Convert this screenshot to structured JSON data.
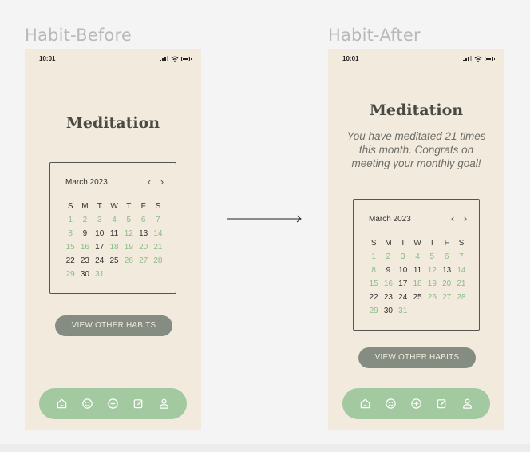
{
  "labels": {
    "before": "Habit-Before",
    "after": "Habit-After"
  },
  "status": {
    "time": "10:01"
  },
  "screen": {
    "title": "Meditation",
    "view_button": "VIEW OTHER HABITS"
  },
  "after_message": "You have meditated 21 times this month. Congrats on meeting your monthly goal!",
  "calendar": {
    "month": "March 2023",
    "prev_icon": "chevron-left-icon",
    "next_icon": "chevron-right-icon",
    "weekdays": [
      "S",
      "M",
      "T",
      "W",
      "T",
      "F",
      "S"
    ],
    "days": [
      {
        "n": "1",
        "s": "green"
      },
      {
        "n": "2",
        "s": "green"
      },
      {
        "n": "3",
        "s": "green"
      },
      {
        "n": "4",
        "s": "green"
      },
      {
        "n": "5",
        "s": "green"
      },
      {
        "n": "6",
        "s": "green"
      },
      {
        "n": "7",
        "s": "green"
      },
      {
        "n": "8",
        "s": "green"
      },
      {
        "n": "9",
        "s": "dark"
      },
      {
        "n": "10",
        "s": "dark"
      },
      {
        "n": "11",
        "s": "dark"
      },
      {
        "n": "12",
        "s": "green"
      },
      {
        "n": "13",
        "s": "dark"
      },
      {
        "n": "14",
        "s": "green"
      },
      {
        "n": "15",
        "s": "green"
      },
      {
        "n": "16",
        "s": "green"
      },
      {
        "n": "17",
        "s": "dark"
      },
      {
        "n": "18",
        "s": "green"
      },
      {
        "n": "19",
        "s": "green"
      },
      {
        "n": "20",
        "s": "green"
      },
      {
        "n": "21",
        "s": "green"
      },
      {
        "n": "22",
        "s": "dark"
      },
      {
        "n": "23",
        "s": "dark"
      },
      {
        "n": "24",
        "s": "dark"
      },
      {
        "n": "25",
        "s": "dark"
      },
      {
        "n": "26",
        "s": "green"
      },
      {
        "n": "27",
        "s": "green"
      },
      {
        "n": "28",
        "s": "green"
      },
      {
        "n": "29",
        "s": "green"
      },
      {
        "n": "30",
        "s": "dark"
      },
      {
        "n": "31",
        "s": "green"
      }
    ]
  },
  "nav": [
    "home-icon",
    "smiley-icon",
    "plus-circle-icon",
    "edit-icon",
    "profile-icon"
  ],
  "colors": {
    "background": "#f2eadc",
    "accent_green": "#a3c9a0",
    "completed_day": "#8dbb8a",
    "button": "#858c82"
  }
}
